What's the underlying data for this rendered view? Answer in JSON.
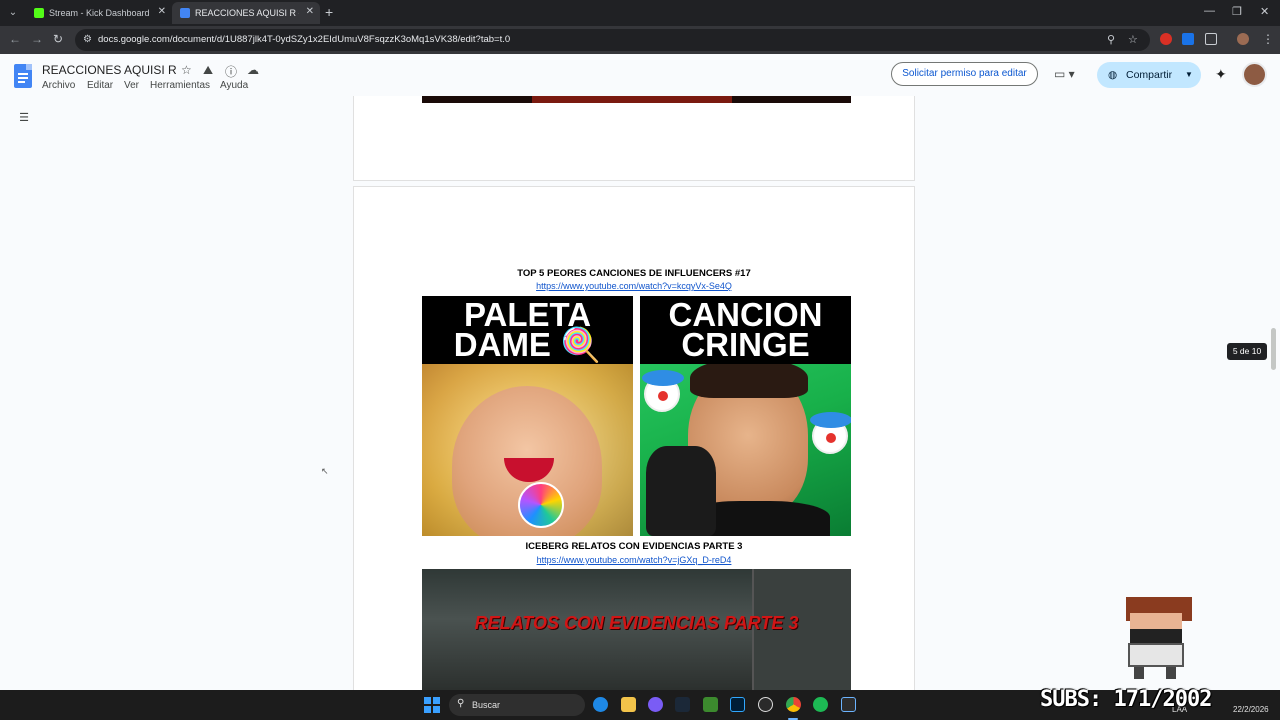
{
  "browser": {
    "tabs": [
      {
        "title": "Stream - Kick Dashboard",
        "active": false,
        "favicon_color": "#53fc18"
      },
      {
        "title": "REACCIONES AQUISI R - Docu",
        "active": true,
        "favicon_color": "#4285f4"
      }
    ],
    "url": "docs.google.com/document/d/1U887jlk4T-0ydSZy1x2EIdUmuV8FsqzzK3oMq1sVK38/edit?tab=t.0"
  },
  "docs": {
    "title": "REACCIONES AQUISI R",
    "menu": [
      "Archivo",
      "Editar",
      "Ver",
      "Herramientas",
      "Ayuda"
    ],
    "request_button": "Solicitar permiso para editar",
    "share_button": "Compartir"
  },
  "document": {
    "entries": [
      {
        "heading": "TOP 5 PEORES CANCIONES DE INFLUENCERS #17",
        "link": "https://www.youtube.com/watch?v=kcqyVx-Se4Q",
        "thumbnail": {
          "left_text": "PALETA\nDAME 🍭",
          "right_text": "CANCION\nCRINGE"
        }
      },
      {
        "heading": "ICEBERG RELATOS CON EVIDENCIAS PARTE 3",
        "link": "https://www.youtube.com/watch?v=jGXq_D-reD4",
        "thumbnail": {
          "text": "RELATOS CON EVIDENCIAS PARTE 3"
        }
      }
    ],
    "page_indicator": "5 de 10"
  },
  "overlay": {
    "subs": "SUBS: 171/2002"
  },
  "taskbar": {
    "search_placeholder": "Buscar",
    "tray_lang": "LAA",
    "date": "22/2/2026"
  },
  "colors": {
    "share_bg": "#c2e7ff",
    "link": "#1155cc",
    "accent": "#0b57d0"
  }
}
